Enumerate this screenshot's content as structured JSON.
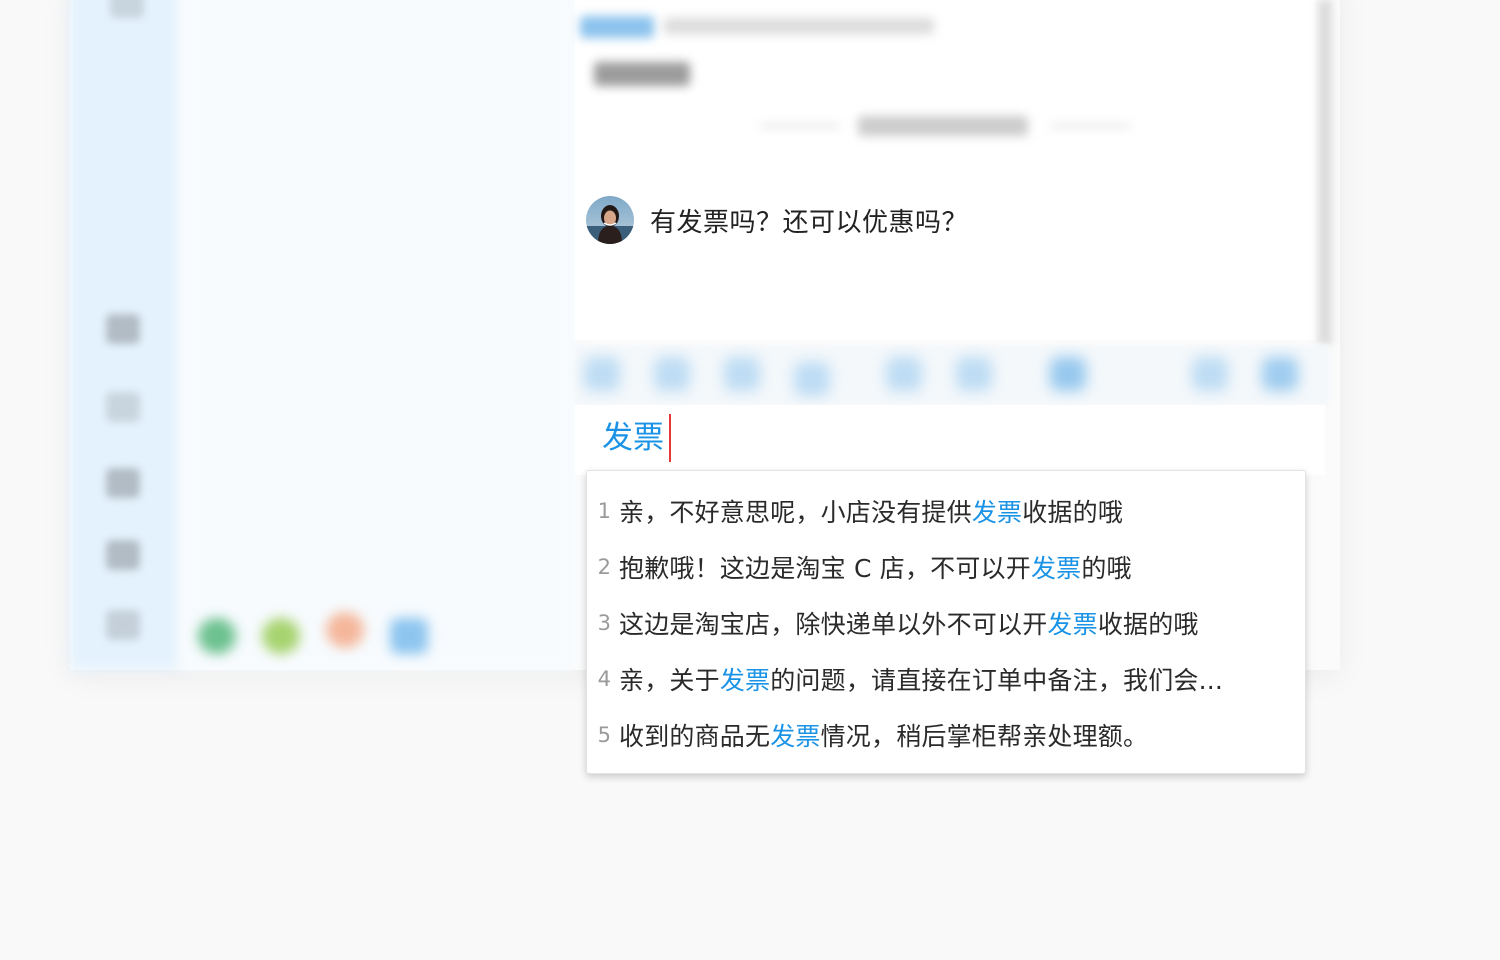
{
  "chat": {
    "message": {
      "avatar_icon": "user-avatar-photo",
      "text": "有发票吗？还可以优惠吗？"
    }
  },
  "input": {
    "value": "发票"
  },
  "suggestions": {
    "highlight_color": "#1a93e6",
    "items": [
      {
        "index": "1",
        "before": "亲，不好意思呢，小店没有提供",
        "keyword": "发票",
        "after": "收据的哦"
      },
      {
        "index": "2",
        "before": "抱歉哦！这边是淘宝 C 店，不可以开",
        "keyword": "发票",
        "after": "的哦"
      },
      {
        "index": "3",
        "before": "这边是淘宝店，除快递单以外不可以开",
        "keyword": "发票",
        "after": "收据的哦"
      },
      {
        "index": "4",
        "before": "亲，关于",
        "keyword": "发票",
        "after": "的问题，请直接在订单中备注，我们会..."
      },
      {
        "index": "5",
        "before": "收到的商品无",
        "keyword": "发票",
        "after": "情况，稍后掌柜帮亲处理额。"
      }
    ]
  },
  "colors": {
    "accent": "#1a93e6",
    "caret": "#e53935",
    "rail_bg": "#e4f2fd"
  }
}
